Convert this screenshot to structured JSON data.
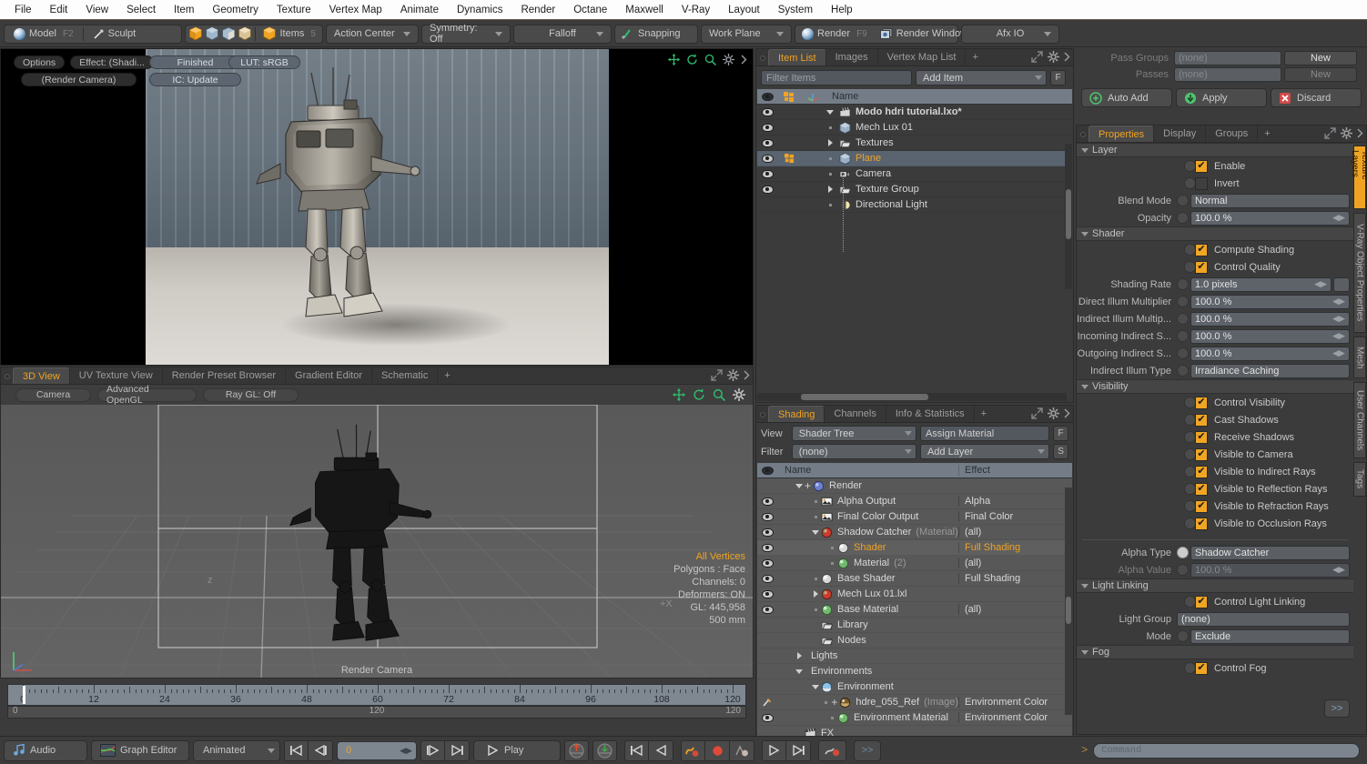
{
  "menu": [
    "File",
    "Edit",
    "View",
    "Select",
    "Item",
    "Geometry",
    "Texture",
    "Vertex Map",
    "Animate",
    "Dynamics",
    "Render",
    "Octane",
    "Maxwell",
    "V-Ray",
    "Layout",
    "System",
    "Help"
  ],
  "toolbar": {
    "mode_model": "Model",
    "mode_model_key": "F2",
    "mode_sculpt": "Sculpt",
    "items_label": "Items",
    "items_key": "5",
    "action_center": "Action Center",
    "symmetry": "Symmetry: Off",
    "falloff": "Falloff",
    "snapping": "Snapping",
    "work_plane": "Work Plane",
    "render": "Render",
    "render_key": "F9",
    "render_window": "Render Window",
    "afx_io": "Afx IO"
  },
  "render_view": {
    "options": "Options",
    "effect": "Effect: (Shadi...",
    "camera": "(Render Camera)",
    "status": "Finished",
    "ic_update": "IC: Update",
    "lut": "LUT: sRGB"
  },
  "viewport_tabs": {
    "tabs": [
      "3D View",
      "UV Texture View",
      "Render Preset Browser",
      "Gradient Editor",
      "Schematic"
    ],
    "active": "3D View",
    "plus": "+"
  },
  "viewport": {
    "camera": "Camera",
    "gl_mode": "Advanced OpenGL",
    "ray_gl": "Ray GL: Off",
    "label_bottom": "Render Camera",
    "axis_x": "+X",
    "axis_z": "z",
    "stats": {
      "selection": "All Vertices",
      "polygons": "Polygons : Face",
      "channels": "Channels: 0",
      "deformers": "Deformers: ON",
      "gl": "GL: 445,958",
      "scale": "500 mm"
    }
  },
  "item_list": {
    "tabs": [
      "Item List",
      "Images",
      "Vertex Map List"
    ],
    "active": "Item List",
    "plus": "+",
    "filter_placeholder": "Filter Items",
    "add_item": "Add Item",
    "f_button": "F",
    "col_name": "Name",
    "rows": [
      {
        "label": "Modo hdri tutorial.lxo*",
        "indent": 0,
        "twisty": "down",
        "icon": "scene-icon",
        "bold": true,
        "selected": false,
        "eye": true,
        "tag": false
      },
      {
        "label": "Mech Lux 01",
        "indent": 1,
        "twisty": "dot",
        "icon": "mesh-icon",
        "bold": false,
        "selected": false,
        "eye": true,
        "tag": false
      },
      {
        "label": "Textures",
        "indent": 1,
        "twisty": "right",
        "icon": "folder-icon",
        "bold": false,
        "selected": false,
        "eye": true,
        "tag": false
      },
      {
        "label": "Plane",
        "indent": 1,
        "twisty": "dot",
        "icon": "mesh-icon",
        "bold": false,
        "selected": true,
        "eye": true,
        "tag": true
      },
      {
        "label": "Camera",
        "indent": 1,
        "twisty": "dot",
        "icon": "camera-icon",
        "bold": false,
        "selected": false,
        "eye": true,
        "tag": false
      },
      {
        "label": "Texture Group",
        "indent": 1,
        "twisty": "right",
        "icon": "folder-icon",
        "bold": false,
        "selected": false,
        "eye": true,
        "tag": false
      },
      {
        "label": "Directional Light",
        "indent": 1,
        "twisty": "dot",
        "icon": "light-icon",
        "bold": false,
        "selected": false,
        "eye": false,
        "tag": false
      }
    ]
  },
  "shading": {
    "tabs": [
      "Shading",
      "Channels",
      "Info & Statistics"
    ],
    "active": "Shading",
    "plus": "+",
    "view_label": "View",
    "view_value": "Shader Tree",
    "assign_material": "Assign Material",
    "f_button": "F",
    "filter_label": "Filter",
    "filter_value": "(none)",
    "add_layer": "Add Layer",
    "s_button": "S",
    "col_name": "Name",
    "col_effect": "Effect",
    "rows": [
      {
        "label": "Render",
        "suffix": "",
        "effect": "",
        "indent": 1,
        "twisty": "down",
        "plus": true,
        "icon": "render-icon",
        "eye": false,
        "selected": false
      },
      {
        "label": "Alpha Output",
        "suffix": "",
        "effect": "Alpha",
        "indent": 2,
        "twisty": "dot",
        "plus": false,
        "icon": "output-icon",
        "eye": true,
        "selected": false
      },
      {
        "label": "Final Color Output",
        "suffix": "",
        "effect": "Final Color",
        "indent": 2,
        "twisty": "dot",
        "plus": false,
        "icon": "output-icon",
        "eye": true,
        "selected": false
      },
      {
        "label": "Shadow Catcher",
        "suffix": "(Material)",
        "effect": "(all)",
        "indent": 2,
        "twisty": "down",
        "plus": false,
        "icon": "material-red-icon",
        "eye": true,
        "selected": false
      },
      {
        "label": "Shader",
        "suffix": "",
        "effect": "Full Shading",
        "indent": 3,
        "twisty": "dot",
        "plus": false,
        "icon": "shader-icon",
        "eye": true,
        "selected": true
      },
      {
        "label": "Material",
        "suffix": "(2)",
        "effect": "(all)",
        "indent": 3,
        "twisty": "dot",
        "plus": false,
        "icon": "material-green-icon",
        "eye": true,
        "selected": false
      },
      {
        "label": "Base Shader",
        "suffix": "",
        "effect": "Full Shading",
        "indent": 2,
        "twisty": "dot",
        "plus": false,
        "icon": "shader-icon",
        "eye": true,
        "selected": false
      },
      {
        "label": "Mech Lux 01.lxl",
        "suffix": "",
        "effect": "",
        "indent": 2,
        "twisty": "right",
        "plus": false,
        "icon": "material-red-icon",
        "eye": true,
        "selected": false
      },
      {
        "label": "Base Material",
        "suffix": "",
        "effect": "(all)",
        "indent": 2,
        "twisty": "dot",
        "plus": false,
        "icon": "material-green-icon",
        "eye": true,
        "selected": false
      },
      {
        "label": "Library",
        "suffix": "",
        "effect": "",
        "indent": 2,
        "twisty": "none",
        "plus": false,
        "icon": "folder-icon",
        "eye": false,
        "selected": false
      },
      {
        "label": "Nodes",
        "suffix": "",
        "effect": "",
        "indent": 2,
        "twisty": "none",
        "plus": false,
        "icon": "folder-icon",
        "eye": false,
        "selected": false
      },
      {
        "label": "Lights",
        "suffix": "",
        "effect": "",
        "indent": 1,
        "twisty": "right",
        "plus": false,
        "icon": "none",
        "eye": false,
        "selected": false
      },
      {
        "label": "Environments",
        "suffix": "",
        "effect": "",
        "indent": 1,
        "twisty": "down",
        "plus": false,
        "icon": "none",
        "eye": false,
        "selected": false
      },
      {
        "label": "Environment",
        "suffix": "",
        "effect": "",
        "indent": 2,
        "twisty": "down",
        "plus": false,
        "icon": "environment-icon",
        "eye": false,
        "selected": false
      },
      {
        "label": "hdre_055_Ref",
        "suffix": "(Image)",
        "effect": "Environment Color",
        "indent": 3,
        "twisty": "dot",
        "plus": true,
        "icon": "image-icon",
        "eye": false,
        "brush": true,
        "selected": false
      },
      {
        "label": "Environment Material",
        "suffix": "",
        "effect": "Environment Color",
        "indent": 3,
        "twisty": "dot",
        "plus": false,
        "icon": "material-green-icon",
        "eye": true,
        "selected": false
      },
      {
        "label": "FX",
        "suffix": "",
        "effect": "",
        "indent": 1,
        "twisty": "none",
        "plus": false,
        "icon": "scene-icon",
        "eye": false,
        "selected": false
      }
    ]
  },
  "passes": {
    "pass_groups_label": "Pass Groups",
    "pass_groups_value": "(none)",
    "pass_groups_new": "New",
    "passes_label": "Passes",
    "passes_value": "(none)",
    "passes_new": "New",
    "auto_add": "Auto Add",
    "apply": "Apply",
    "discard": "Discard"
  },
  "properties": {
    "tabs": [
      "Properties",
      "Display",
      "Groups"
    ],
    "active": "Properties",
    "plus": "+",
    "side_tabs": [
      "Texture Layers",
      "V-Ray Object Properties",
      "Mesh",
      "User Channels",
      "Tags"
    ],
    "side_active": "Texture Layers",
    "sections": [
      {
        "title": "Layer",
        "items": [
          {
            "kind": "check",
            "label": "Enable",
            "checked": true
          },
          {
            "kind": "check",
            "label": "Invert",
            "checked": false
          },
          {
            "kind": "combo",
            "label": "Blend Mode",
            "value": "Normal"
          },
          {
            "kind": "value",
            "label": "Opacity",
            "value": "100.0 %"
          }
        ]
      },
      {
        "title": "Shader",
        "items": [
          {
            "kind": "check",
            "label": "Compute Shading",
            "checked": true
          },
          {
            "kind": "check",
            "label": "Control Quality",
            "checked": true
          },
          {
            "kind": "value_combo",
            "label": "Shading Rate",
            "value": "1.0 pixels"
          },
          {
            "kind": "value",
            "label": "Direct Illum Multiplier",
            "value": "100.0 %"
          },
          {
            "kind": "value",
            "label": "Indirect Illum Multip...",
            "value": "100.0 %"
          },
          {
            "kind": "value",
            "label": "Incoming Indirect S...",
            "value": "100.0 %"
          },
          {
            "kind": "value",
            "label": "Outgoing Indirect S...",
            "value": "100.0 %"
          },
          {
            "kind": "combo",
            "label": "Indirect Illum Type",
            "value": "Irradiance Caching"
          }
        ]
      },
      {
        "title": "Visibility",
        "items": [
          {
            "kind": "check",
            "label": "Control Visibility",
            "checked": true
          },
          {
            "kind": "check",
            "label": "Cast Shadows",
            "checked": true
          },
          {
            "kind": "check",
            "label": "Receive Shadows",
            "checked": true
          },
          {
            "kind": "check",
            "label": "Visible to Camera",
            "checked": true
          },
          {
            "kind": "check",
            "label": "Visible to Indirect Rays",
            "checked": true
          },
          {
            "kind": "check",
            "label": "Visible to Reflection Rays",
            "checked": true
          },
          {
            "kind": "check",
            "label": "Visible to Refraction Rays",
            "checked": true
          },
          {
            "kind": "check",
            "label": "Visible to Occlusion Rays",
            "checked": true
          },
          {
            "kind": "gap"
          },
          {
            "kind": "combo",
            "label": "Alpha Type",
            "value": "Shadow Catcher",
            "knob_on": true
          },
          {
            "kind": "value",
            "label": "Alpha Value",
            "value": "100.0 %",
            "disabled": true
          }
        ]
      },
      {
        "title": "Light Linking",
        "items": [
          {
            "kind": "check",
            "label": "Control Light Linking",
            "checked": true
          },
          {
            "kind": "combo_plain",
            "label": "Light Group",
            "value": "(none)"
          },
          {
            "kind": "combo",
            "label": "Mode",
            "value": "Exclude"
          }
        ]
      },
      {
        "title": "Fog",
        "items": [
          {
            "kind": "check",
            "label": "Control Fog",
            "checked": true
          }
        ]
      }
    ],
    "expand_button": ">>"
  },
  "timeline": {
    "ticks": [
      "0",
      "12",
      "24",
      "36",
      "48",
      "60",
      "72",
      "84",
      "96",
      "108",
      "120"
    ],
    "sub_start": "0",
    "sub_mid": "120",
    "sub_end": "120"
  },
  "bottom": {
    "audio": "Audio",
    "graph_editor": "Graph Editor",
    "animated": "Animated",
    "frame": "0",
    "play": "Play",
    "more": ">>"
  },
  "command": {
    "prompt": ">",
    "placeholder": "Command"
  },
  "colors": {
    "accent": "#f0a323",
    "panel": "#3b3b3b",
    "field": "#5e636a",
    "header": "#747d87",
    "selection": "#5a6470"
  }
}
